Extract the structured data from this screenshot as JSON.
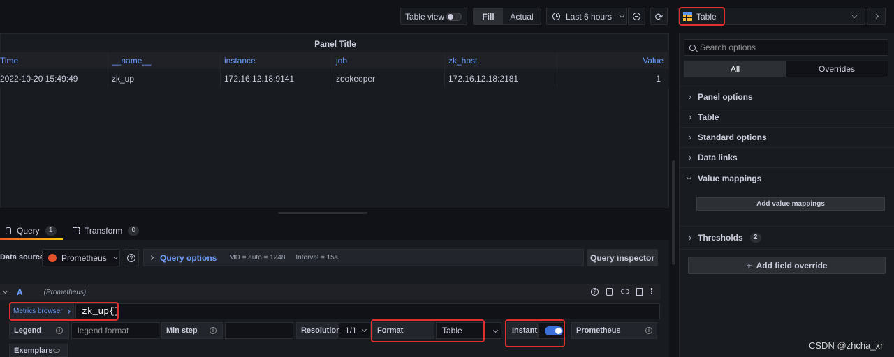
{
  "toolbar": {
    "table_view_label": "Table view",
    "fill_label": "Fill",
    "actual_label": "Actual",
    "time_range_label": "Last 6 hours",
    "viz_label": "Table"
  },
  "panel": {
    "title": "Panel Title",
    "columns": [
      "Time",
      "__name__",
      "instance",
      "job",
      "zk_host",
      "Value"
    ],
    "rows": [
      [
        "2022-10-20 15:49:49",
        "zk_up",
        "172.16.12.18:9141",
        "zookeeper",
        "172.16.12.18:2181",
        "1"
      ]
    ]
  },
  "tabs": {
    "query_label": "Query",
    "query_count": "1",
    "transform_label": "Transform",
    "transform_count": "0"
  },
  "query_bar": {
    "data_source_label": "Data source",
    "data_source_value": "Prometheus",
    "query_options_label": "Query options",
    "md_info": "MD = auto = 1248",
    "interval_info": "Interval = 15s",
    "inspector_label": "Query inspector"
  },
  "query_row": {
    "ref_id": "A",
    "source": "(Prometheus)",
    "metrics_browser_label": "Metrics browser",
    "query_text": "zk_up{}",
    "legend_label": "Legend",
    "legend_placeholder": "legend format",
    "min_step_label": "Min step",
    "resolution_label": "Resolution",
    "resolution_value": "1/1",
    "format_label": "Format",
    "format_value": "Table",
    "instant_label": "Instant",
    "instant_on": true,
    "prometheus_label": "Prometheus",
    "exemplars_label": "Exemplars"
  },
  "options_pane": {
    "search_placeholder": "Search options",
    "tab_all": "All",
    "tab_overrides": "Overrides",
    "sections": {
      "panel_options": "Panel options",
      "table": "Table",
      "standard_options": "Standard options",
      "data_links": "Data links",
      "value_mappings": "Value mappings",
      "thresholds": "Thresholds"
    },
    "thresholds_count": "2",
    "add_value_mappings_label": "Add value mappings",
    "add_field_override_label": "Add field override"
  },
  "watermark": "CSDN @zhcha_xr",
  "colors": {
    "accent_blue": "#6e9fff",
    "highlight_red": "#e02f2f",
    "toggle_blue": "#3d71d9",
    "prometheus_orange": "#e6522c",
    "tab_active_orange": "#f05a28"
  }
}
